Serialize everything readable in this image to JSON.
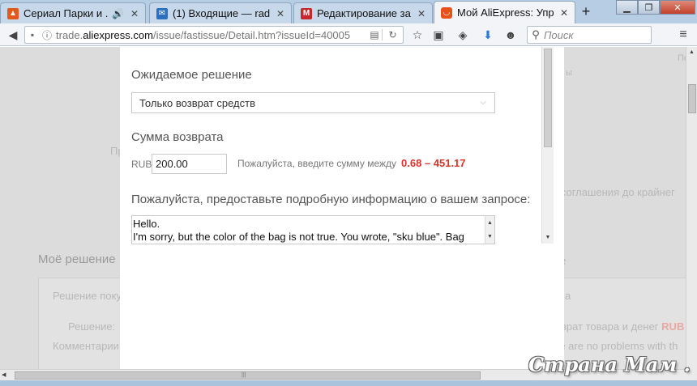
{
  "browser": {
    "tabs": [
      {
        "title": "Сериал Парки и ...",
        "favicon": "fire-icon",
        "favicon_color": "#e05a1c",
        "audio": true
      },
      {
        "title": "(1) Входящие — rad...",
        "favicon": "mail-icon",
        "favicon_color": "#2b6fbd"
      },
      {
        "title": "Редактирование за...",
        "favicon": "m-logo-icon",
        "favicon_color": "#c62828"
      },
      {
        "title": "Мой AliExpress: Упр...",
        "favicon": "aliexpress-icon",
        "favicon_color": "#e8501e",
        "active": true
      }
    ],
    "new_tab": "+",
    "url_prefix": "trade.",
    "url_domain": "aliexpress.com",
    "url_path": "/issue/fastissue/Detail.htm?issueId=40005",
    "search_placeholder": "Поиск"
  },
  "background": {
    "right_top_fragment": "Пе",
    "right_small": "ы",
    "left_fragment_1": "Пр",
    "right_fragment_agreement": "е соглашения до крайнег",
    "section_heading": "Моё решение",
    "decision_heading_left": "Решение поку",
    "decision_heading_right": "а",
    "decision_label": "Решение:",
    "decision_value_text": "зврат товара и денег",
    "decision_value_currency": "RUB",
    "comment_label": "Комментарии",
    "comment_value": "re are no problems with th",
    "right_fragment_e": "е"
  },
  "modal": {
    "expected_solution_label": "Ожидаемое решение",
    "expected_solution_value": "Только возврат средств",
    "refund_sum_label": "Сумма возврата",
    "currency": "RUB",
    "amount_value": "200.00",
    "amount_hint": "Пожалуйста, введите сумму между",
    "amount_range": "0.68 – 451.17",
    "details_label": "Пожалуйста, предоставьте подробную информацию о вашем запросе:",
    "details_text": "Hello.\nI'm sorry, but the color of the bag is not true. You wrote, \"sku blue\". Bag"
  },
  "watermark": "Страна Мам . ру",
  "colors": {
    "accent_red": "#d9342b",
    "page_overlay": "#dcdcdc"
  }
}
